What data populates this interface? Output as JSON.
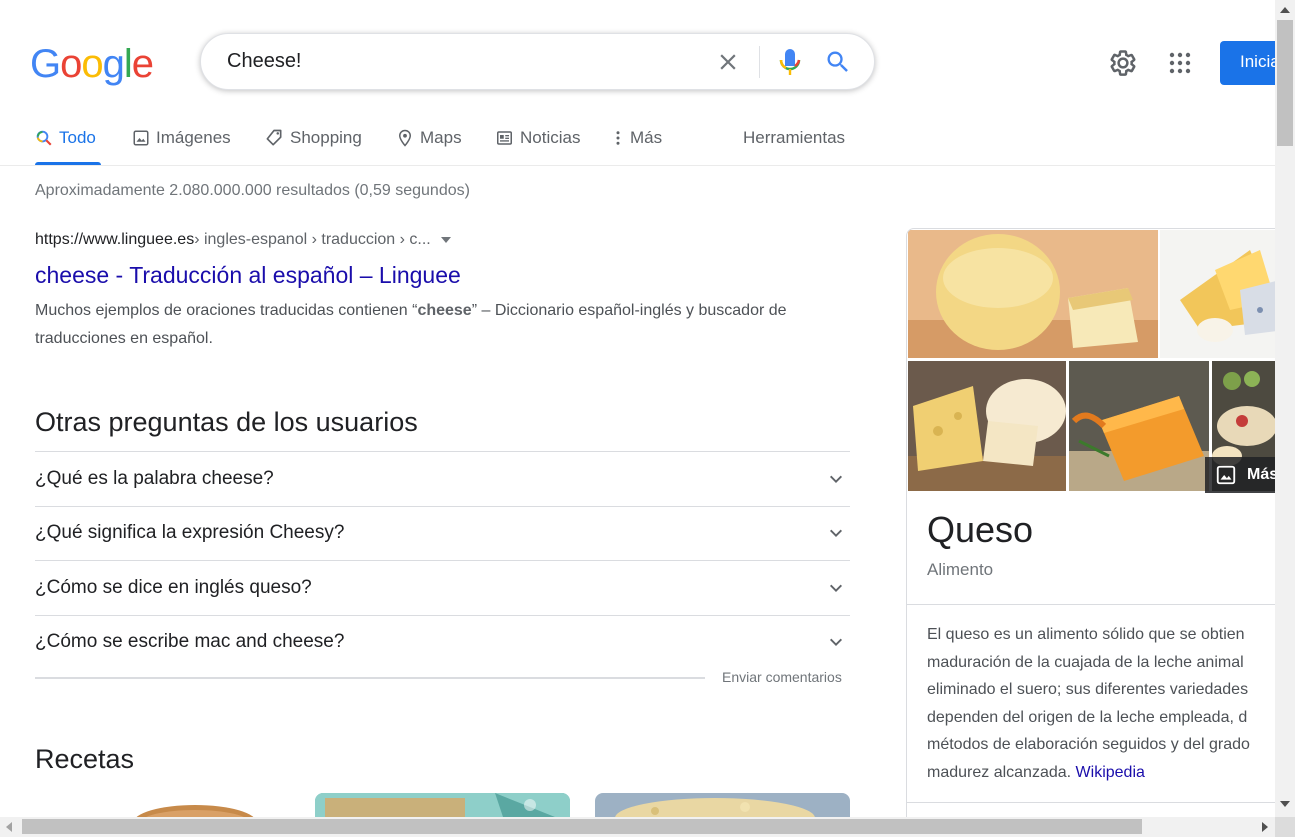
{
  "header": {
    "logo_letters": [
      "G",
      "o",
      "o",
      "g",
      "l",
      "e"
    ],
    "logo_colors": [
      "#4285F4",
      "#EA4335",
      "#FBBC05",
      "#4285F4",
      "#34A853",
      "#EA4335"
    ],
    "search_value": "Cheese!",
    "signin_label": "Inicia"
  },
  "tabs": [
    {
      "label": "Todo",
      "icon": "search-icon"
    },
    {
      "label": "Imágenes",
      "icon": "image-icon"
    },
    {
      "label": "Shopping",
      "icon": "tag-icon"
    },
    {
      "label": "Maps",
      "icon": "map-pin-icon"
    },
    {
      "label": "Noticias",
      "icon": "news-icon"
    },
    {
      "label": "Más",
      "icon": "more-vert-icon"
    }
  ],
  "tools_label": "Herramientas",
  "stats": "Aproximadamente 2.080.000.000 resultados (0,59 segundos)",
  "result": {
    "domain": "https://www.linguee.es",
    "path": " › ingles-espanol › traduccion › c...",
    "title": "cheese - Traducción al español – Linguee",
    "snippet_before": "Muchos ejemplos de oraciones traducidas contienen “",
    "snippet_bold": "cheese",
    "snippet_after": "” – Diccionario español-inglés y buscador de traducciones en español."
  },
  "paa": {
    "heading": "Otras preguntas de los usuarios",
    "questions": [
      "¿Qué es la palabra cheese?",
      "¿Qué significa la expresión Cheesy?",
      "¿Cómo se dice en inglés queso?",
      "¿Cómo se escribe mac and cheese?"
    ],
    "feedback": "Enviar comentarios"
  },
  "recipes": {
    "heading": "Recetas"
  },
  "knowledge_panel": {
    "title": "Queso",
    "subtitle": "Alimento",
    "more_images": "Más",
    "description_lines": [
      "El queso es un alimento sólido que se obtien",
      "maduración de la cuajada de la leche animal",
      "eliminado el suero; sus diferentes variedades",
      "dependen del origen de la leche empleada, d",
      "métodos de elaboración seguidos y del grado",
      "madurez alcanzada. "
    ],
    "source_link": "Wikipedia"
  },
  "colors": {
    "accent": "#1a73e8",
    "link": "#1a0dab"
  }
}
